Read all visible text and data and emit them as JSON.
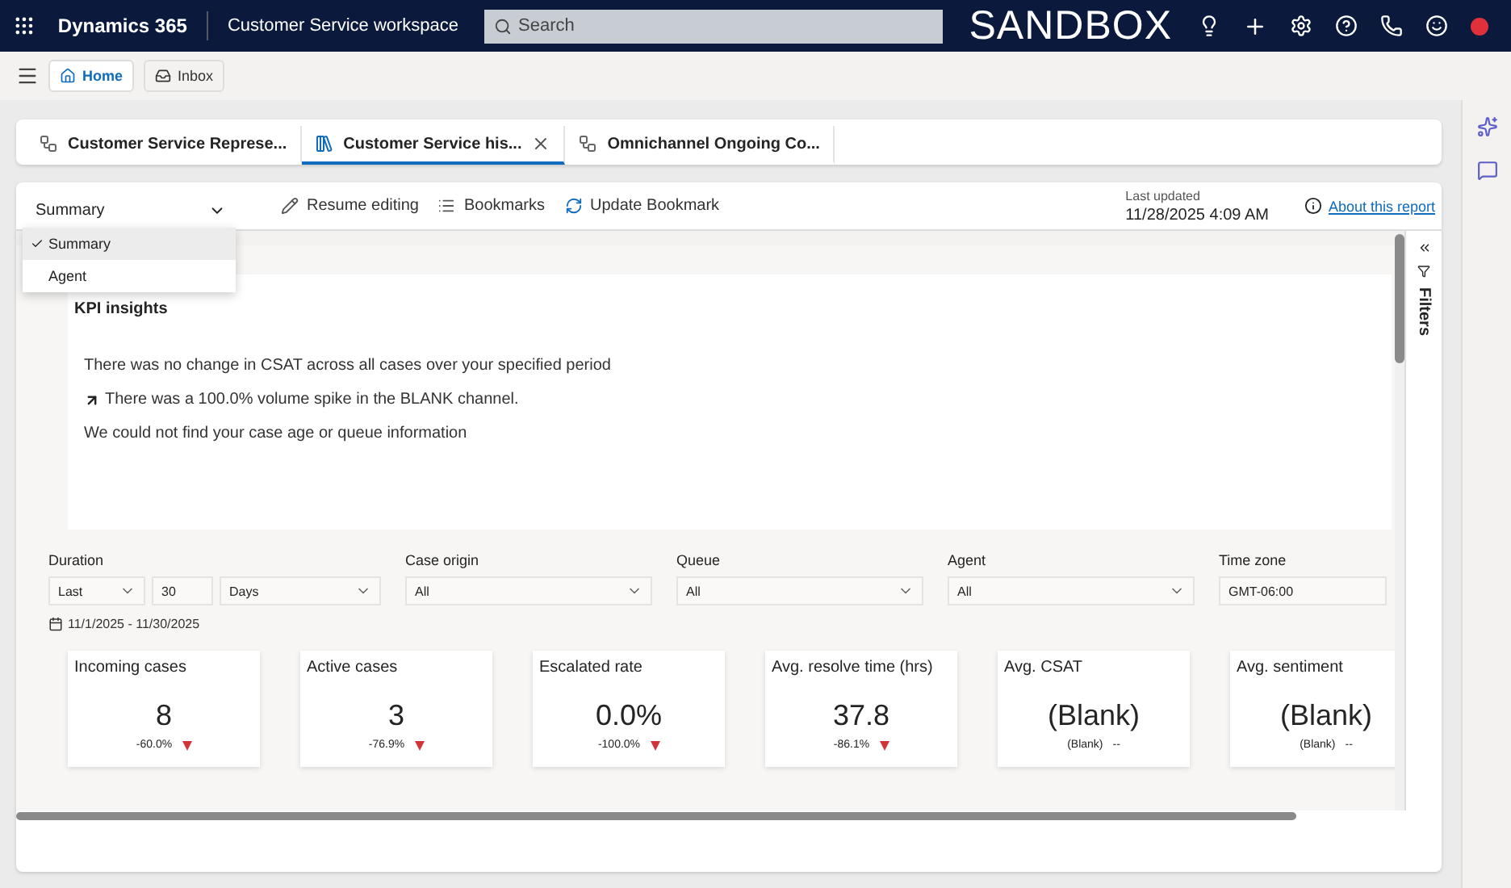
{
  "topbar": {
    "app": "Dynamics 365",
    "workspace": "Customer Service workspace",
    "search": {
      "placeholder": "Search"
    },
    "environment": "SANDBOX"
  },
  "nav_buttons": [
    {
      "label": "Home",
      "selected": true,
      "kind": "home"
    },
    {
      "label": "Inbox",
      "selected": false,
      "kind": "inbox"
    }
  ],
  "session_tabs": [
    {
      "label": "Customer Service Represe...",
      "selected": false,
      "kind": "dashboard"
    },
    {
      "label": "Customer Service his...",
      "selected": true,
      "kind": "report"
    },
    {
      "label": "Omnichannel Ongoing Co...",
      "selected": false,
      "kind": "dashboard"
    }
  ],
  "report": {
    "view_select": {
      "value": "Summary",
      "options": [
        {
          "label": "Summary",
          "selected": true
        },
        {
          "label": "Agent",
          "selected": false
        }
      ]
    },
    "actions": [
      {
        "label": "Resume editing",
        "kind": "edit"
      },
      {
        "label": "Bookmarks",
        "kind": "bookmarks"
      },
      {
        "label": "Update Bookmark",
        "kind": "refresh"
      }
    ],
    "last_updated_label": "Last updated",
    "last_updated": "11/28/2025 4:09 AM",
    "about_link": "About this report",
    "insights": {
      "title": "KPI insights",
      "lines": [
        {
          "text": "There was no change in CSAT across all cases over your specified period",
          "kind": "plain"
        },
        {
          "text": "There was a 100.0% volume spike in the BLANK channel.",
          "kind": "rise"
        },
        {
          "text": "We could not find your case age or queue information",
          "kind": "plain"
        }
      ]
    },
    "filters": [
      {
        "label": "Duration",
        "fields": [
          {
            "value": "Last",
            "kind": "select"
          },
          {
            "value": "30",
            "kind": "input"
          },
          {
            "value": "Days",
            "kind": "select"
          }
        ]
      },
      {
        "label": "Case origin",
        "fields": [
          {
            "value": "All",
            "kind": "select"
          }
        ]
      },
      {
        "label": "Queue",
        "fields": [
          {
            "value": "All",
            "kind": "select"
          }
        ]
      },
      {
        "label": "Agent",
        "fields": [
          {
            "value": "All",
            "kind": "select"
          }
        ]
      },
      {
        "label": "Time zone",
        "fields": [
          {
            "value": "GMT-06:00",
            "kind": "input"
          }
        ]
      }
    ],
    "date_range": "11/1/2025 - 11/30/2025",
    "kpis": [
      {
        "title": "Incoming cases",
        "value": "8",
        "change": "-60.0%",
        "kind": "fall"
      },
      {
        "title": "Active cases",
        "value": "3",
        "change": "-76.9%",
        "kind": "fall"
      },
      {
        "title": "Escalated rate",
        "value": "0.0%",
        "change": "-100.0%",
        "kind": "fall"
      },
      {
        "title": "Avg. resolve time (hrs)",
        "value": "37.8",
        "change": "-86.1%",
        "kind": "fall"
      },
      {
        "title": "Avg. CSAT",
        "value": "(Blank)",
        "change": "(Blank)",
        "kind": "blank",
        "indicator": "--"
      },
      {
        "title": "Avg. sentiment",
        "value": "(Blank)",
        "change": "(Blank)",
        "kind": "blank",
        "indicator": "--"
      }
    ],
    "filters_pane": {
      "label": "Filters"
    }
  }
}
